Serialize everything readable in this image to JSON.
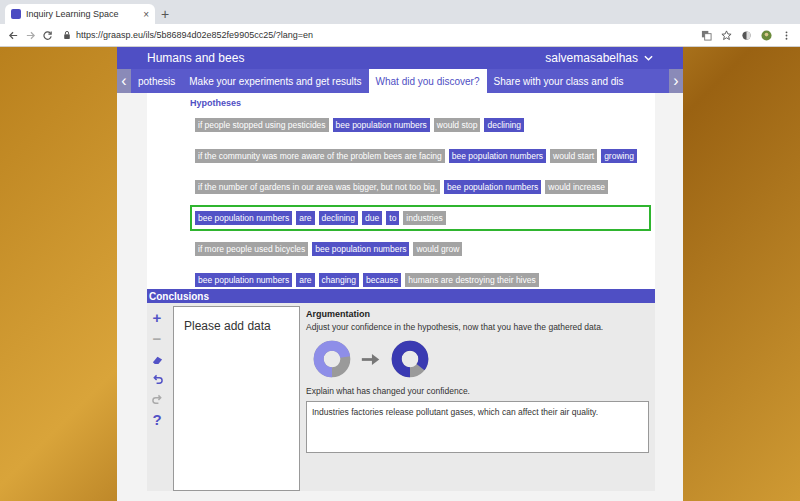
{
  "browser": {
    "tab": {
      "title": "Inquiry Learning Space",
      "close": "×",
      "selected": true
    },
    "new_tab": "+",
    "url": "https://graasp.eu/ils/5b86894d02e852fe9905cc25/?lang=en"
  },
  "header": {
    "title": "Humans and bees",
    "user": "salvemasabelhas"
  },
  "tabs": {
    "prev": "‹",
    "next": "›",
    "items": [
      {
        "label": "pothesis",
        "selected": false
      },
      {
        "label": "Make your experiments and get results",
        "selected": false
      },
      {
        "label": "What did you discover?",
        "selected": true
      },
      {
        "label": "Share with your class and dis",
        "selected": false
      }
    ]
  },
  "hypotheses": {
    "label": "Hypotheses",
    "rows": [
      {
        "selected": false,
        "chips": [
          {
            "text": "if people stopped using pesticides",
            "color": "#a3a3a3"
          },
          {
            "text": "bee population numbers",
            "color": "#5252c6"
          },
          {
            "text": "would stop",
            "color": "#a3a3a3"
          },
          {
            "text": "declining",
            "color": "#5252c6"
          }
        ]
      },
      {
        "selected": false,
        "chips": [
          {
            "text": "if the community was more aware of the problem bees are facing",
            "color": "#a3a3a3"
          },
          {
            "text": "bee population numbers",
            "color": "#5252c6"
          },
          {
            "text": "would start",
            "color": "#a3a3a3"
          },
          {
            "text": "growing",
            "color": "#5252c6"
          }
        ]
      },
      {
        "selected": false,
        "chips": [
          {
            "text": "if the number of gardens in our area was bigger, but not too big,",
            "color": "#a3a3a3"
          },
          {
            "text": "bee population numbers",
            "color": "#5252c6"
          },
          {
            "text": "would increase",
            "color": "#a3a3a3"
          }
        ]
      },
      {
        "selected": true,
        "chips": [
          {
            "text": "bee population numbers",
            "color": "#5252c6"
          },
          {
            "text": "are",
            "color": "#5252c6"
          },
          {
            "text": "declining",
            "color": "#5252c6"
          },
          {
            "text": "due",
            "color": "#5252c6"
          },
          {
            "text": "to",
            "color": "#5252c6"
          },
          {
            "text": "industries",
            "color": "#a3a3a3"
          }
        ]
      },
      {
        "selected": false,
        "chips": [
          {
            "text": "if more people used bicycles",
            "color": "#a3a3a3"
          },
          {
            "text": "bee population numbers",
            "color": "#5252c6"
          },
          {
            "text": "would grow",
            "color": "#a3a3a3"
          }
        ]
      },
      {
        "selected": false,
        "chips": [
          {
            "text": "bee population numbers",
            "color": "#5252c6"
          },
          {
            "text": "are",
            "color": "#5252c6"
          },
          {
            "text": "changing",
            "color": "#5252c6"
          },
          {
            "text": "because",
            "color": "#5252c6"
          },
          {
            "text": "humans are destroying their hives",
            "color": "#a3a3a3"
          }
        ]
      }
    ]
  },
  "conclusions": {
    "title": "Conclusions",
    "tools": [
      {
        "kind": "glyph",
        "text": "+",
        "disabled": false
      },
      {
        "kind": "glyph",
        "text": "−",
        "disabled": true
      },
      {
        "kind": "eraser",
        "text": "",
        "disabled": false
      },
      {
        "kind": "undo",
        "text": "",
        "disabled": false
      },
      {
        "kind": "redo",
        "text": "",
        "disabled": true
      },
      {
        "kind": "glyph",
        "text": "?",
        "disabled": false
      }
    ],
    "data_placeholder": "Please add data",
    "argumentation": {
      "title": "Argumentation",
      "instruction": "Adjust your confidence in the hypothesis, now that you have the gathered data.",
      "confidence_before": {
        "level": 0.72,
        "color": "#8e8ee8"
      },
      "confidence_after": {
        "level": 0.85,
        "color": "#3a3ab2"
      },
      "explain_label": "Explain what has changed your confidence.",
      "explanation": "Industries factories release pollutant gases, which can affect their air quality."
    }
  }
}
